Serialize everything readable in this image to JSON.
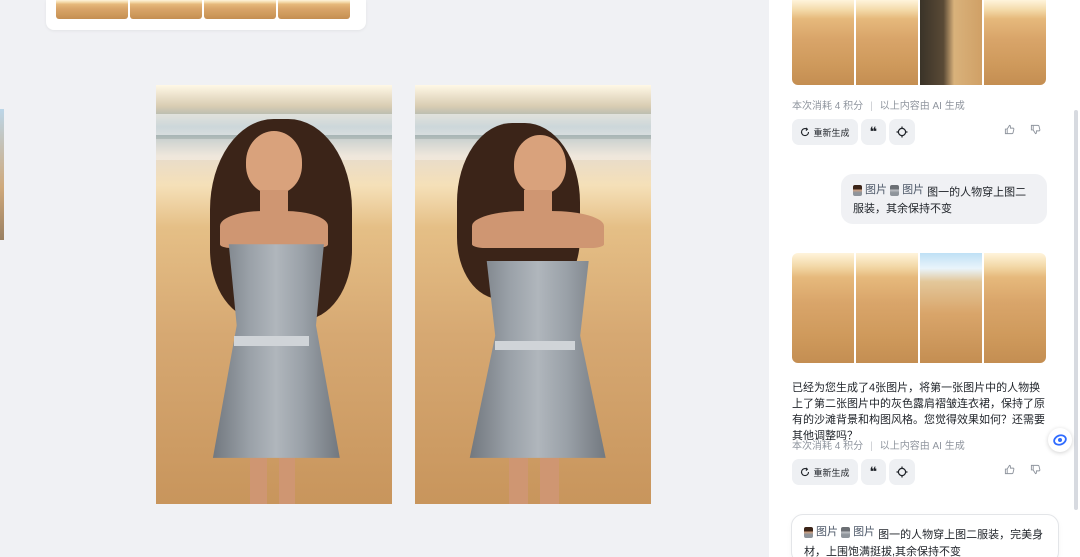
{
  "canvas": {
    "main_images": [
      {
        "name": "main-image-original"
      },
      {
        "name": "main-image-result"
      }
    ]
  },
  "conversation": {
    "message_1": {
      "cost": "本次消耗 4 积分",
      "disclaimer": "以上内容由 AI 生成",
      "regenerate_label": "重新生成"
    },
    "user_prompt_1": {
      "ref1": "图片",
      "ref2": "图片",
      "text": "图一的人物穿上图二服装，其余保持不变"
    },
    "message_2": {
      "reply": "已经为您生成了4张图片，将第一张图片中的人物换上了第二张图片中的灰色露肩褶皱连衣裙，保持了原有的沙滩背景和构图风格。您觉得效果如何？还需要其他调整吗？",
      "cost": "本次消耗 4 积分",
      "disclaimer": "以上内容由 AI 生成",
      "regenerate_label": "重新生成"
    },
    "composer": {
      "ref1": "图片",
      "ref2": "图片",
      "text": "图一的人物穿上图二服装，完美身材，上围饱满挺拔,其余保持不变"
    }
  },
  "colors": {
    "accent": "#2f6bff",
    "canvas_bg": "#f0f1f4",
    "panel_bg": "#ffffff",
    "muted_text": "#8f959e"
  },
  "icons": [
    "regenerate-icon",
    "quote-icon",
    "crosshair-icon",
    "thumbs-up-icon",
    "thumbs-down-icon",
    "assistant-float-icon"
  ]
}
